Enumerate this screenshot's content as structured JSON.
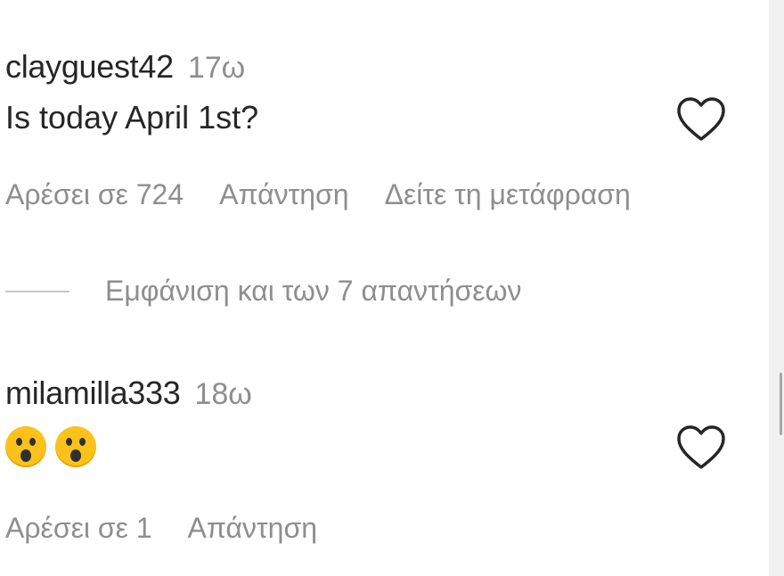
{
  "comments": [
    {
      "username": "clayguest42",
      "time": "17ω",
      "text": "Is today April 1st?",
      "actions": {
        "likes": "Αρέσει σε 724",
        "reply": "Απάντηση",
        "translate": "Δείτε τη μετάφραση"
      },
      "view_replies": "Εμφάνιση και των 7 απαντήσεων"
    },
    {
      "username": "milamilla333",
      "time": "18ω",
      "emoji": [
        "astonished-face",
        "astonished-face"
      ],
      "actions": {
        "likes": "Αρέσει σε 1",
        "reply": "Απάντηση"
      }
    }
  ],
  "colors": {
    "text": "#262626",
    "muted": "#8e8e8e",
    "emoji": "#fcc21b"
  }
}
